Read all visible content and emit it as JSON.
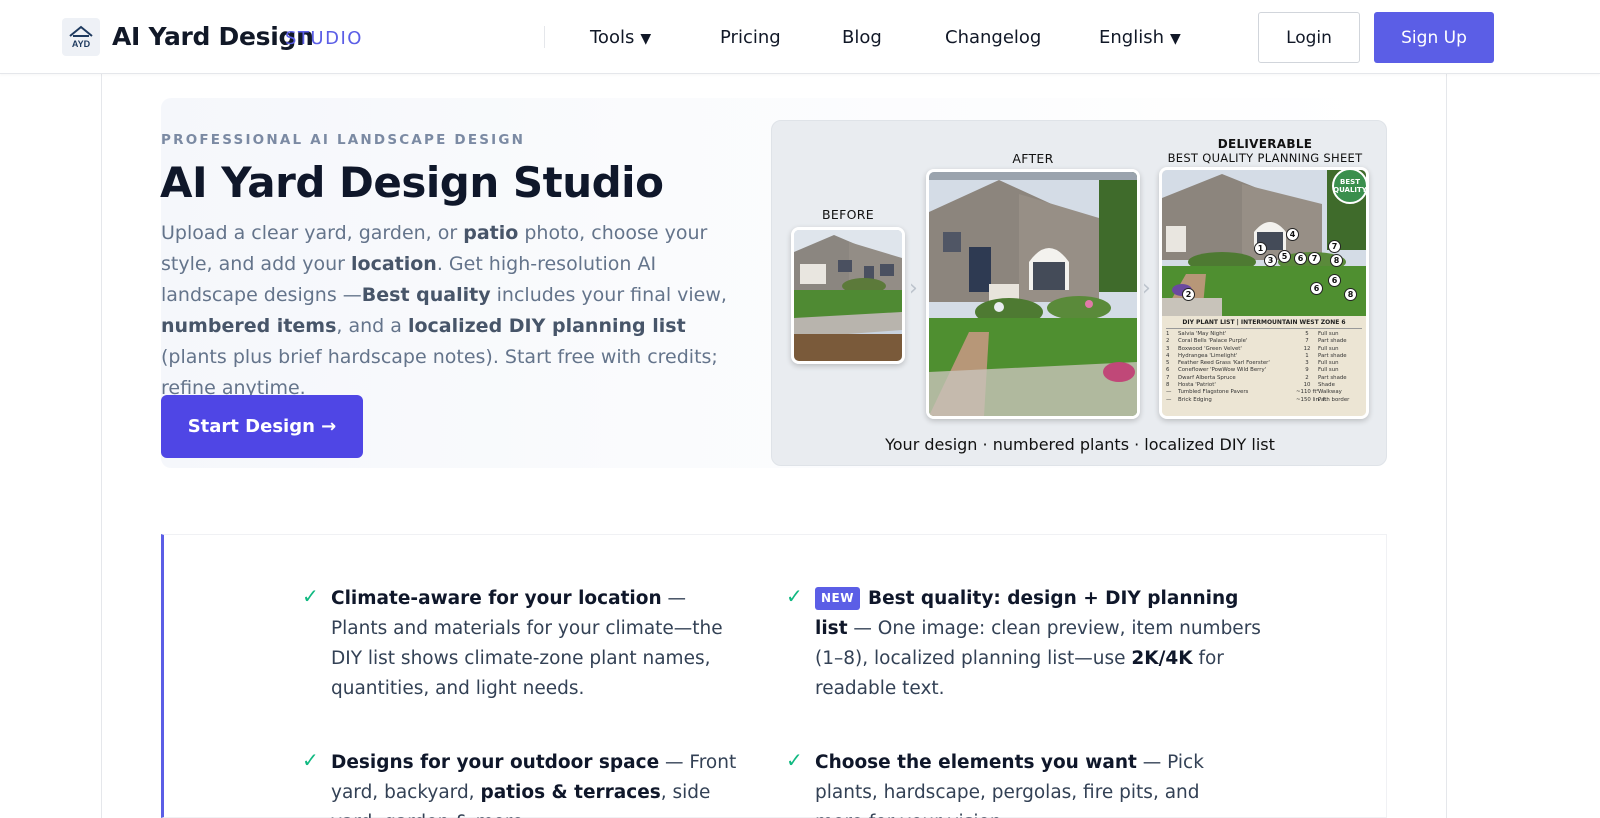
{
  "nav": {
    "brand": "AI Yard Design",
    "brand_sub": "STUDIO",
    "logo_text": "AYD",
    "links": [
      {
        "label": "Tools",
        "caret": "▼"
      },
      {
        "label": "Pricing"
      },
      {
        "label": "Blog"
      },
      {
        "label": "Changelog"
      },
      {
        "label": "English",
        "caret": "▼"
      }
    ],
    "login": "Login",
    "signup": "Sign Up"
  },
  "hero": {
    "eyebrow": "PROFESSIONAL AI LANDSCAPE DESIGN",
    "title": "AI Yard Design Studio",
    "desc": {
      "p1": "Upload a clear yard, garden, or ",
      "b1": "patio",
      "p2": " photo, choose your style, and add your ",
      "b2": "location",
      "p3": ". Get high-resolution AI landscape designs —",
      "b3": "Best quality",
      "p4": " includes your final view, ",
      "b4": "numbered items",
      "p5": ", and a ",
      "b5": "localized DIY planning list",
      "p6": " (plants plus brief hardscape notes). Start free with credits; refine anytime."
    },
    "cta": "Start Design →"
  },
  "showcase": {
    "before_label": "BEFORE",
    "after_label": "AFTER",
    "deliverable_label": "DELIVERABLE",
    "deliverable_sub": "BEST QUALITY PLANNING SHEET",
    "badge_line1": "BEST",
    "badge_line2": "QUALITY",
    "caption": "Your design · numbered plants · localized DIY list",
    "plant_list_title": "DIY PLANT LIST | INTERMOUNTAIN WEST ZONE 6",
    "plant_rows": [
      [
        "1",
        "Salvia 'May Night'",
        "5",
        "Full sun"
      ],
      [
        "2",
        "Coral Bells 'Palace Purple'",
        "7",
        "Part shade"
      ],
      [
        "3",
        "Boxwood 'Green Velvet'",
        "12",
        "Full sun"
      ],
      [
        "4",
        "Hydrangea 'Limelight'",
        "1",
        "Part shade"
      ],
      [
        "5",
        "Feather Reed Grass 'Karl Foerster'",
        "3",
        "Full sun"
      ],
      [
        "6",
        "Coneflower 'PowWow Wild Berry'",
        "9",
        "Full sun"
      ],
      [
        "7",
        "Dwarf Alberta Spruce",
        "2",
        "Part shade"
      ],
      [
        "8",
        "Hosta 'Patriot'",
        "10",
        "Shade"
      ],
      [
        "—",
        "Tumbled Flagstone Pavers",
        "~110 ft²",
        "Walkway"
      ],
      [
        "—",
        "Brick Edging",
        "~150 lin. ft.",
        "Path border"
      ]
    ],
    "markers": [
      "1",
      "2",
      "3",
      "4",
      "5",
      "6",
      "7",
      "8"
    ]
  },
  "features": [
    {
      "title": "Climate-aware for your location",
      "text": " — Plants and materials for your climate—the DIY list shows climate-zone plant names, quantities, and light needs."
    },
    {
      "badge": "NEW",
      "title": "Best quality: design + DIY planning list",
      "text_a": " — One image: clean preview, item numbers (1–8), localized planning list—use ",
      "bold": "2K/4K",
      "text_b": " for readable text."
    },
    {
      "title": "Designs for your outdoor space",
      "text_a": " — Front yard, backyard, ",
      "bold": "patios & terraces",
      "text_b": ", side yard, garden & more."
    },
    {
      "title": "Choose the elements you want",
      "text": " — Pick plants, hardscape, pergolas, fire pits, and more for your vision."
    }
  ],
  "check": "✓"
}
